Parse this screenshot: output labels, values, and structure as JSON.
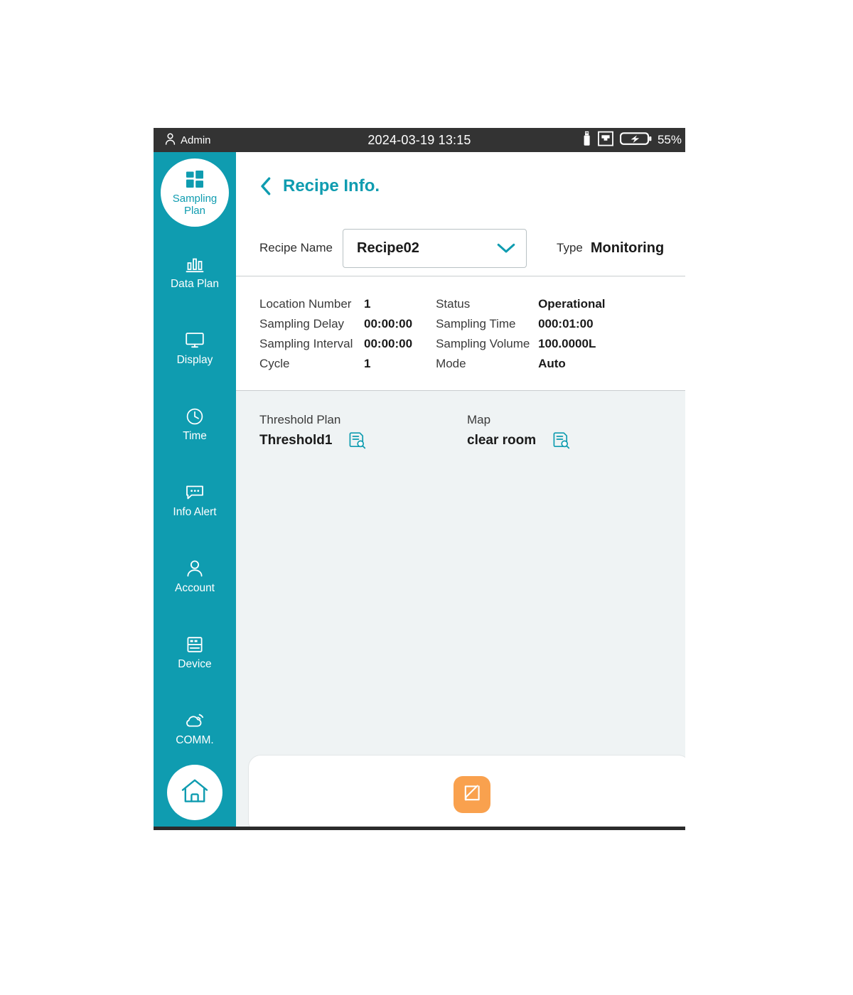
{
  "statusbar": {
    "user_icon": "person-icon",
    "user": "Admin",
    "datetime": "2024-03-19 13:15",
    "usb_icon": "usb-drive-icon",
    "network_icon": "ethernet-icon",
    "battery_icon": "battery-charging-icon",
    "battery_percent": "55%"
  },
  "sidebar": {
    "items": [
      {
        "label": "Sampling\nPlan",
        "label_line1": "Sampling",
        "label_line2": "Plan",
        "icon": "grid-squares-icon",
        "active": true
      },
      {
        "label": "Data Plan",
        "icon": "bar-chart-icon",
        "active": false
      },
      {
        "label": "Display",
        "icon": "monitor-icon",
        "active": false
      },
      {
        "label": "Time",
        "icon": "clock-icon",
        "active": false
      },
      {
        "label": "Info Alert",
        "icon": "speech-bubble-icon",
        "active": false
      },
      {
        "label": "Account",
        "icon": "person-icon",
        "active": false
      },
      {
        "label": "Device",
        "icon": "server-rack-icon",
        "active": false
      },
      {
        "label": "COMM.",
        "icon": "cloud-signal-icon",
        "active": false
      }
    ],
    "home_icon": "home-icon"
  },
  "header": {
    "back_icon": "chevron-left-icon",
    "title": "Recipe Info."
  },
  "recipe": {
    "name_label": "Recipe Name",
    "name_value": "Recipe02",
    "dropdown_icon": "chevron-down-icon",
    "type_label": "Type",
    "type_value": "Monitoring"
  },
  "details": {
    "left": [
      {
        "key": "Location Number",
        "value": "1"
      },
      {
        "key": "Sampling Delay",
        "value": "00:00:00"
      },
      {
        "key": "Sampling Interval",
        "value": "00:00:00"
      },
      {
        "key": "Cycle",
        "value": "1"
      }
    ],
    "right": [
      {
        "key": "Status",
        "value": "Operational"
      },
      {
        "key": "Sampling Time",
        "value": "000:01:00"
      },
      {
        "key": "Sampling Volume",
        "value": "100.0000L"
      },
      {
        "key": "Mode",
        "value": "Auto"
      }
    ]
  },
  "plans": [
    {
      "title": "Threshold Plan",
      "value": "Threshold1",
      "view_icon": "document-search-icon"
    },
    {
      "title": "Map",
      "value": "clear room",
      "view_icon": "document-search-icon"
    }
  ],
  "footer": {
    "edit_icon": "edit-square-icon"
  },
  "colors": {
    "accent_teal": "#0f9cb0",
    "statusbar_bg": "#333333",
    "content_bg": "#eff3f4",
    "edit_orange": "#f9a14e"
  }
}
